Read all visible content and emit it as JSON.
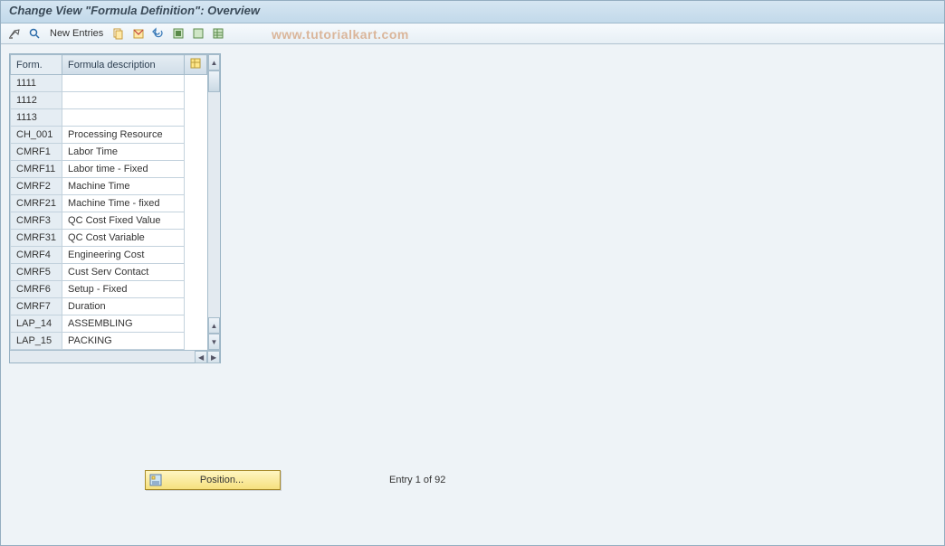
{
  "title": "Change View \"Formula Definition\": Overview",
  "toolbar": {
    "new_entries": "New Entries"
  },
  "watermark": "www.tutorialkart.com",
  "table": {
    "headers": {
      "form": "Form.",
      "desc": "Formula description"
    },
    "rows": [
      {
        "form": "1111",
        "desc": ""
      },
      {
        "form": "1112",
        "desc": ""
      },
      {
        "form": "1113",
        "desc": ""
      },
      {
        "form": "CH_001",
        "desc": "Processing Resource"
      },
      {
        "form": "CMRF1",
        "desc": "Labor Time"
      },
      {
        "form": "CMRF11",
        "desc": "Labor time - Fixed"
      },
      {
        "form": "CMRF2",
        "desc": "Machine Time"
      },
      {
        "form": "CMRF21",
        "desc": "Machine Time - fixed"
      },
      {
        "form": "CMRF3",
        "desc": "QC Cost Fixed Value"
      },
      {
        "form": "CMRF31",
        "desc": "QC Cost Variable"
      },
      {
        "form": "CMRF4",
        "desc": "Engineering Cost"
      },
      {
        "form": "CMRF5",
        "desc": "Cust Serv Contact"
      },
      {
        "form": "CMRF6",
        "desc": "Setup - Fixed"
      },
      {
        "form": "CMRF7",
        "desc": "Duration"
      },
      {
        "form": "LAP_14",
        "desc": "ASSEMBLING"
      },
      {
        "form": "LAP_15",
        "desc": "PACKING"
      }
    ]
  },
  "footer": {
    "position_label": "Position...",
    "entry_text": "Entry 1 of 92"
  }
}
